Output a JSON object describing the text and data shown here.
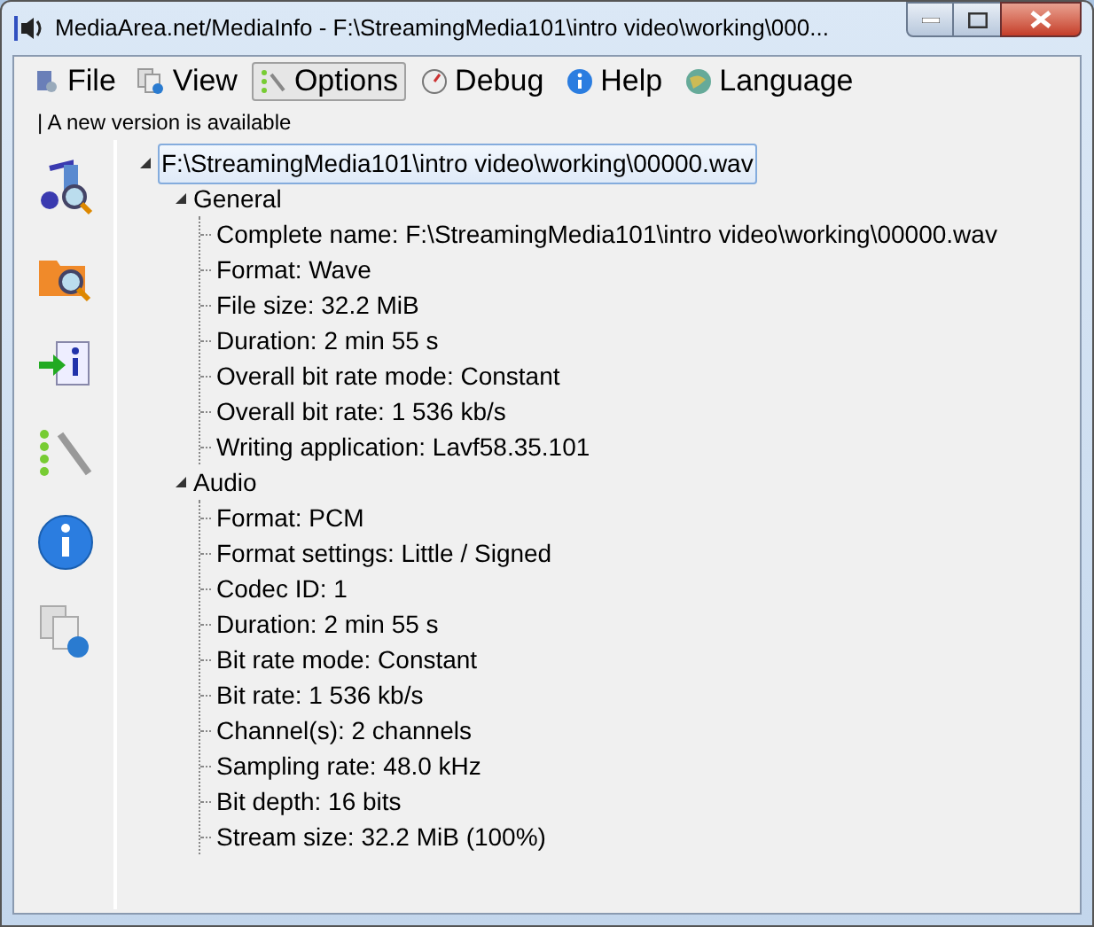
{
  "window": {
    "title": "MediaArea.net/MediaInfo - F:\\StreamingMedia101\\intro video\\working\\000..."
  },
  "menu": [
    {
      "label": "File",
      "selected": false
    },
    {
      "label": "View",
      "selected": false
    },
    {
      "label": "Options",
      "selected": true
    },
    {
      "label": "Debug",
      "selected": false
    },
    {
      "label": "Help",
      "selected": false
    },
    {
      "label": "Language",
      "selected": false
    }
  ],
  "update_notice": "| A new version is available",
  "tree": {
    "label": "F:\\StreamingMedia101\\intro video\\working\\00000.wav",
    "expanded": true,
    "selected": true,
    "children": [
      {
        "label": "General",
        "expanded": true,
        "children": [
          {
            "label": "Complete name: F:\\StreamingMedia101\\intro video\\working\\00000.wav"
          },
          {
            "label": "Format: Wave"
          },
          {
            "label": "File size: 32.2 MiB"
          },
          {
            "label": "Duration: 2 min 55 s"
          },
          {
            "label": "Overall bit rate mode: Constant"
          },
          {
            "label": "Overall bit rate: 1 536 kb/s"
          },
          {
            "label": "Writing application: Lavf58.35.101"
          }
        ]
      },
      {
        "label": "Audio",
        "expanded": true,
        "children": [
          {
            "label": "Format: PCM"
          },
          {
            "label": "Format settings: Little / Signed"
          },
          {
            "label": "Codec ID: 1"
          },
          {
            "label": "Duration: 2 min 55 s"
          },
          {
            "label": "Bit rate mode: Constant"
          },
          {
            "label": "Bit rate: 1 536 kb/s"
          },
          {
            "label": "Channel(s): 2 channels"
          },
          {
            "label": "Sampling rate: 48.0 kHz"
          },
          {
            "label": "Bit depth: 16 bits"
          },
          {
            "label": "Stream size: 32.2 MiB (100%)"
          }
        ]
      }
    ]
  }
}
